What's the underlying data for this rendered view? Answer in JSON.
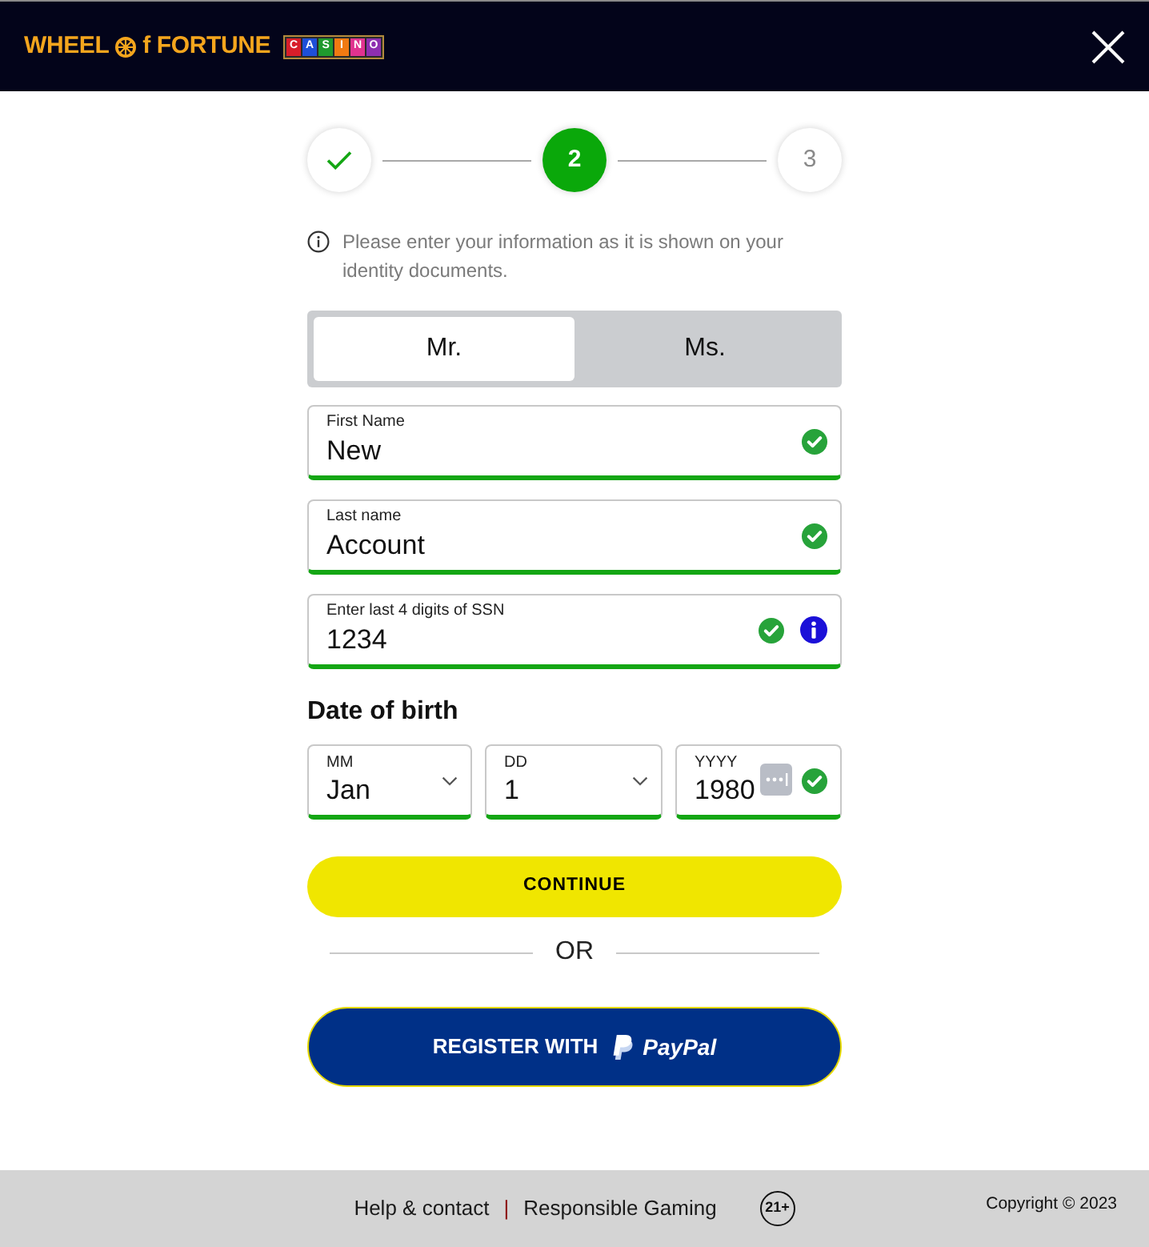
{
  "header": {
    "logo": {
      "lead": "WHEEL",
      "tail": "f FORTUNE",
      "tiles": [
        {
          "letter": "C",
          "color": "#d81e2a"
        },
        {
          "letter": "A",
          "color": "#1e4fd8"
        },
        {
          "letter": "S",
          "color": "#1f9a2e"
        },
        {
          "letter": "I",
          "color": "#f07a12"
        },
        {
          "letter": "N",
          "color": "#e0338f"
        },
        {
          "letter": "O",
          "color": "#8d2fb0"
        }
      ]
    }
  },
  "stepper": {
    "steps": [
      {
        "done": true,
        "selected": false
      },
      {
        "label": "2",
        "done": false,
        "selected": true
      },
      {
        "label": "3",
        "done": false,
        "selected": false
      }
    ]
  },
  "notice": "Please enter your information as it is shown on your identity documents.",
  "title_toggle": [
    {
      "label": "Mr.",
      "selected": true
    },
    {
      "label": "Ms.",
      "selected": false
    }
  ],
  "fields": [
    {
      "label": "First Name",
      "value": "New",
      "valid": true,
      "info": false
    },
    {
      "label": "Last name",
      "value": "Account",
      "valid": true,
      "info": false
    },
    {
      "label": "Enter last 4 digits of SSN",
      "value": "1234",
      "valid": true,
      "info": true
    }
  ],
  "date_of_birth": {
    "heading": "Date of birth",
    "fields": [
      {
        "kind": "select",
        "label": "MM",
        "value": "Jan",
        "valid": true
      },
      {
        "kind": "select",
        "label": "DD",
        "value": "1",
        "valid": true
      },
      {
        "kind": "text",
        "label": "YYYY",
        "value": "1980",
        "valid": true
      }
    ]
  },
  "continue_button": "CONTINUE",
  "divider": "OR",
  "paypal_button": {
    "label": "REGISTER WITH",
    "brand": "PayPal"
  },
  "footer": {
    "links": [
      "Help & contact",
      "Responsible Gaming"
    ],
    "separator": "|",
    "age_badge": "21+",
    "copyright": "Copyright © 2023"
  }
}
